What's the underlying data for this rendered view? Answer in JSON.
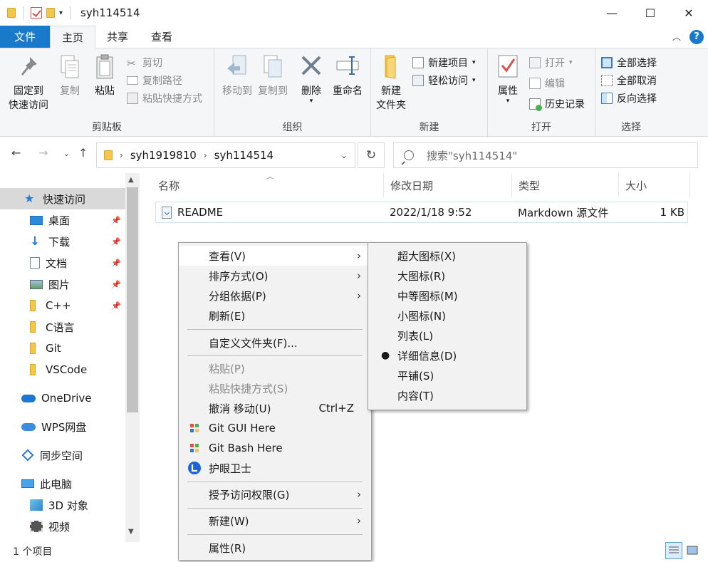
{
  "window": {
    "title": "syh114514",
    "minimize": "—",
    "maximize": "☐",
    "close": "✕"
  },
  "tabs": [
    "文件",
    "主页",
    "共享",
    "查看"
  ],
  "ribbon": {
    "clipboard": {
      "label": "剪贴板",
      "pin_line1": "固定到",
      "pin_line2": "快速访问",
      "copy": "复制",
      "paste": "粘贴",
      "cut": "剪切",
      "copy_path": "复制路径",
      "paste_shortcut": "粘贴快捷方式"
    },
    "organize": {
      "label": "组织",
      "move_to": "移动到",
      "copy_to": "复制到",
      "delete": "删除",
      "rename": "重命名"
    },
    "new": {
      "label": "新建",
      "new_folder_line1": "新建",
      "new_folder_line2": "文件夹",
      "new_item": "新建项目",
      "easy_access": "轻松访问"
    },
    "open": {
      "label": "打开",
      "properties": "属性",
      "open": "打开",
      "edit": "编辑",
      "history": "历史记录"
    },
    "select": {
      "label": "选择",
      "select_all": "全部选择",
      "select_none": "全部取消",
      "invert": "反向选择"
    }
  },
  "address": {
    "crumbs": [
      "syh1919810",
      "syh114514"
    ],
    "search_placeholder": "搜索\"syh114514\""
  },
  "sidebar": {
    "items": [
      {
        "label": "快速访问",
        "icon": "star-icon"
      },
      {
        "label": "桌面",
        "icon": "desktop-icon"
      },
      {
        "label": "下载",
        "icon": "download-icon"
      },
      {
        "label": "文档",
        "icon": "document-icon"
      },
      {
        "label": "图片",
        "icon": "picture-icon"
      },
      {
        "label": "C++",
        "icon": "folder-icon"
      },
      {
        "label": "C语言",
        "icon": "folder-icon"
      },
      {
        "label": "Git",
        "icon": "folder-icon"
      },
      {
        "label": "VSCode",
        "icon": "folder-icon"
      },
      {
        "label": "OneDrive",
        "icon": "cloud-icon"
      },
      {
        "label": "WPS网盘",
        "icon": "wps-cloud-icon"
      },
      {
        "label": "同步空间",
        "icon": "sync-icon"
      },
      {
        "label": "此电脑",
        "icon": "computer-icon"
      },
      {
        "label": "3D 对象",
        "icon": "cube-icon"
      },
      {
        "label": "视频",
        "icon": "video-icon"
      }
    ]
  },
  "columns": {
    "name": "名称",
    "modified": "修改日期",
    "type": "类型",
    "size": "大小"
  },
  "files": [
    {
      "name": "README",
      "modified": "2022/1/18 9:52",
      "type": "Markdown 源文件",
      "size": "1 KB"
    }
  ],
  "status": {
    "count": "1 个项目"
  },
  "context_menu": {
    "view": "查看(V)",
    "sort": "排序方式(O)",
    "group": "分组依据(P)",
    "refresh": "刷新(E)",
    "customize": "自定义文件夹(F)...",
    "paste": "粘贴(P)",
    "paste_shortcut": "粘贴快捷方式(S)",
    "undo": "撤消 移动(U)",
    "undo_shortcut": "Ctrl+Z",
    "git_gui": "Git GUI Here",
    "git_bash": "Git Bash Here",
    "eye_guard": "护眼卫士",
    "grant_access": "授予访问权限(G)",
    "new": "新建(W)",
    "properties": "属性(R)"
  },
  "view_submenu": {
    "items": [
      "超大图标(X)",
      "大图标(R)",
      "中等图标(M)",
      "小图标(N)",
      "列表(L)",
      "详细信息(D)",
      "平铺(S)",
      "内容(T)"
    ],
    "selected": "详细信息(D)"
  },
  "colors": {
    "accent": "#1979ca",
    "folder": "#f3c74c"
  }
}
